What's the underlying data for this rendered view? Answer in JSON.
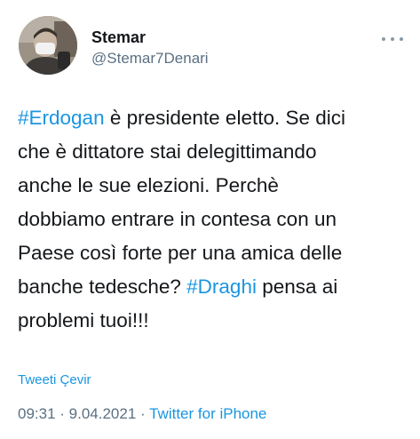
{
  "author": {
    "display_name": "Stemar",
    "handle": "@Stemar7Denari"
  },
  "more_icon": "more-horizontal-icon",
  "tweet": {
    "lines": [
      [
        {
          "text": "#Erdogan",
          "hashtag": true
        },
        {
          "text": " è presidente eletto. Se dici",
          "hashtag": false
        }
      ],
      [
        {
          "text": "che è dittatore stai delegittimando",
          "hashtag": false
        }
      ],
      [
        {
          "text": "anche le sue elezioni. Perchè",
          "hashtag": false
        }
      ],
      [
        {
          "text": "dobbiamo entrare in contesa con un",
          "hashtag": false
        }
      ],
      [
        {
          "text": "Paese così forte per una amica delle",
          "hashtag": false
        }
      ],
      [
        {
          "text": "banche tedesche? ",
          "hashtag": false
        },
        {
          "text": "#Draghi",
          "hashtag": true
        },
        {
          "text": " pensa ai",
          "hashtag": false
        }
      ],
      [
        {
          "text": "problemi tuoi!!!",
          "hashtag": false
        }
      ]
    ]
  },
  "translate_label": "Tweeti Çevir",
  "meta": {
    "time": "09:31",
    "separator": " · ",
    "date": "9.04.2021",
    "source": "Twitter for iPhone"
  },
  "colors": {
    "link": "#1b95e0",
    "secondary": "#5b7083",
    "text": "#14171a"
  }
}
